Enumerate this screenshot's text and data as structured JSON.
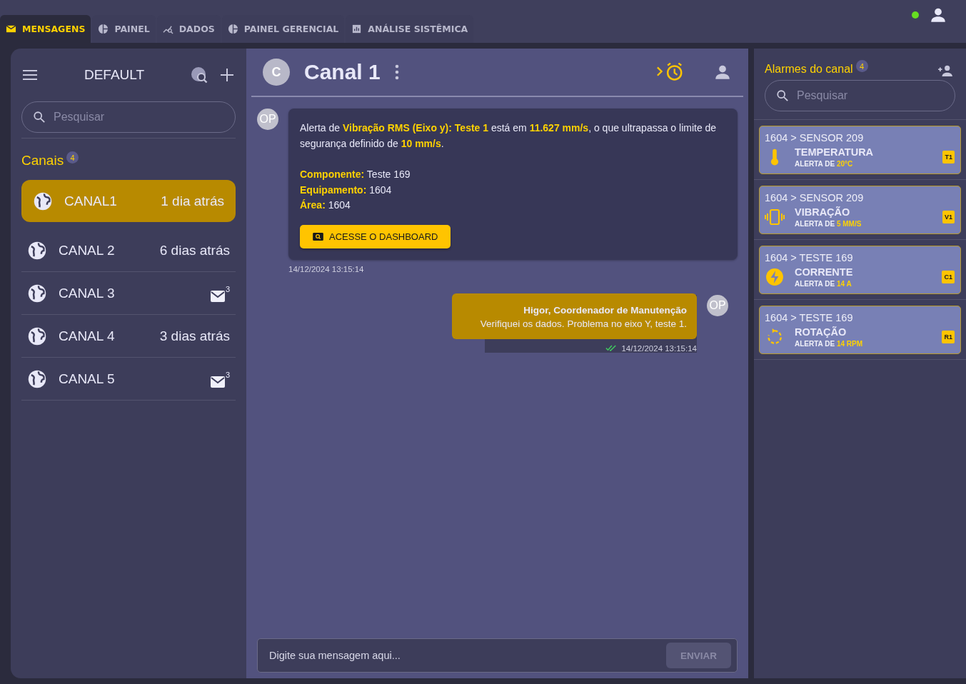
{
  "tabs": [
    {
      "label": "MENSAGENS",
      "kind": "mail",
      "selected": true
    },
    {
      "label": "PAINEL",
      "kind": "pie",
      "selected": false
    },
    {
      "label": "DADOS",
      "kind": "trend",
      "selected": false
    },
    {
      "label": "PAINEL GERENCIAL",
      "kind": "pie",
      "selected": false
    },
    {
      "label": "ANÁLISE SISTÊMICA",
      "kind": "bars",
      "selected": false
    }
  ],
  "user_status": {
    "online": true
  },
  "sidebar": {
    "title": "DEFAULT",
    "search": {
      "placeholder": "Pesquisar"
    },
    "section": "Canais",
    "section_count": "4",
    "channels": [
      {
        "name": "CANAL1",
        "time": "1 dia atrás",
        "selected": true
      },
      {
        "name": "CANAL 2",
        "time": "6 dias atrás",
        "selected": false
      },
      {
        "name": "CANAL 3",
        "unread": "3",
        "selected": false
      },
      {
        "name": "CANAL 4",
        "time": "3 dias atrás",
        "selected": false
      },
      {
        "name": "CANAL 5",
        "unread": "3",
        "selected": false
      }
    ]
  },
  "chat": {
    "avatar": "C",
    "title": "Canal 1",
    "messages": [
      {
        "kind": "alert",
        "avatar": "OP",
        "text": "Alerta de **Vibração RMS (Eixo y): Teste 1** está em **11.627 mm/s**, o que ultrapassa o limite de segurança definido de **10 mm/s**.",
        "fields": [
          "**Componente:** Teste 169",
          "**Equipamento:** 1604",
          "**Área:** 1604"
        ],
        "button": "ACESSE O DASHBOARD",
        "time": "14/12/2024 13:15:14"
      },
      {
        "kind": "own",
        "avatar": "OP",
        "author": "Higor, Coordenador de Manutenção",
        "text": "Verifiquei os dados. Problema no eixo Y, teste 1.",
        "read": true,
        "time": "14/12/2024 13:15:14"
      }
    ],
    "composer": {
      "placeholder": "Digite sua mensagem aqui...",
      "button": "ENVIAR",
      "disabled": true
    }
  },
  "alarms": {
    "title": "Alarmes do canal",
    "count": "4",
    "search": {
      "placeholder": "Pesquisar"
    },
    "items": [
      {
        "path": "1604 > SENSOR 209",
        "kind": "temperature",
        "name": "TEMPERATURA",
        "label": "ALERTA DE",
        "value": "20°C",
        "tag": "T1"
      },
      {
        "path": "1604 > SENSOR 209",
        "kind": "vibration",
        "name": "VIBRAÇÃO",
        "label": "ALERTA DE",
        "value": "5 MM/S",
        "tag": "V1"
      },
      {
        "path": "1604 > TESTE 169",
        "kind": "current",
        "name": "CORRENTE",
        "label": "ALERTA DE",
        "value": "14 A",
        "tag": "C1"
      },
      {
        "path": "1604 > TESTE 169",
        "kind": "rotation",
        "name": "ROTAÇÃO",
        "label": "ALERTA DE",
        "value": "14 RPM",
        "tag": "R1"
      }
    ]
  }
}
